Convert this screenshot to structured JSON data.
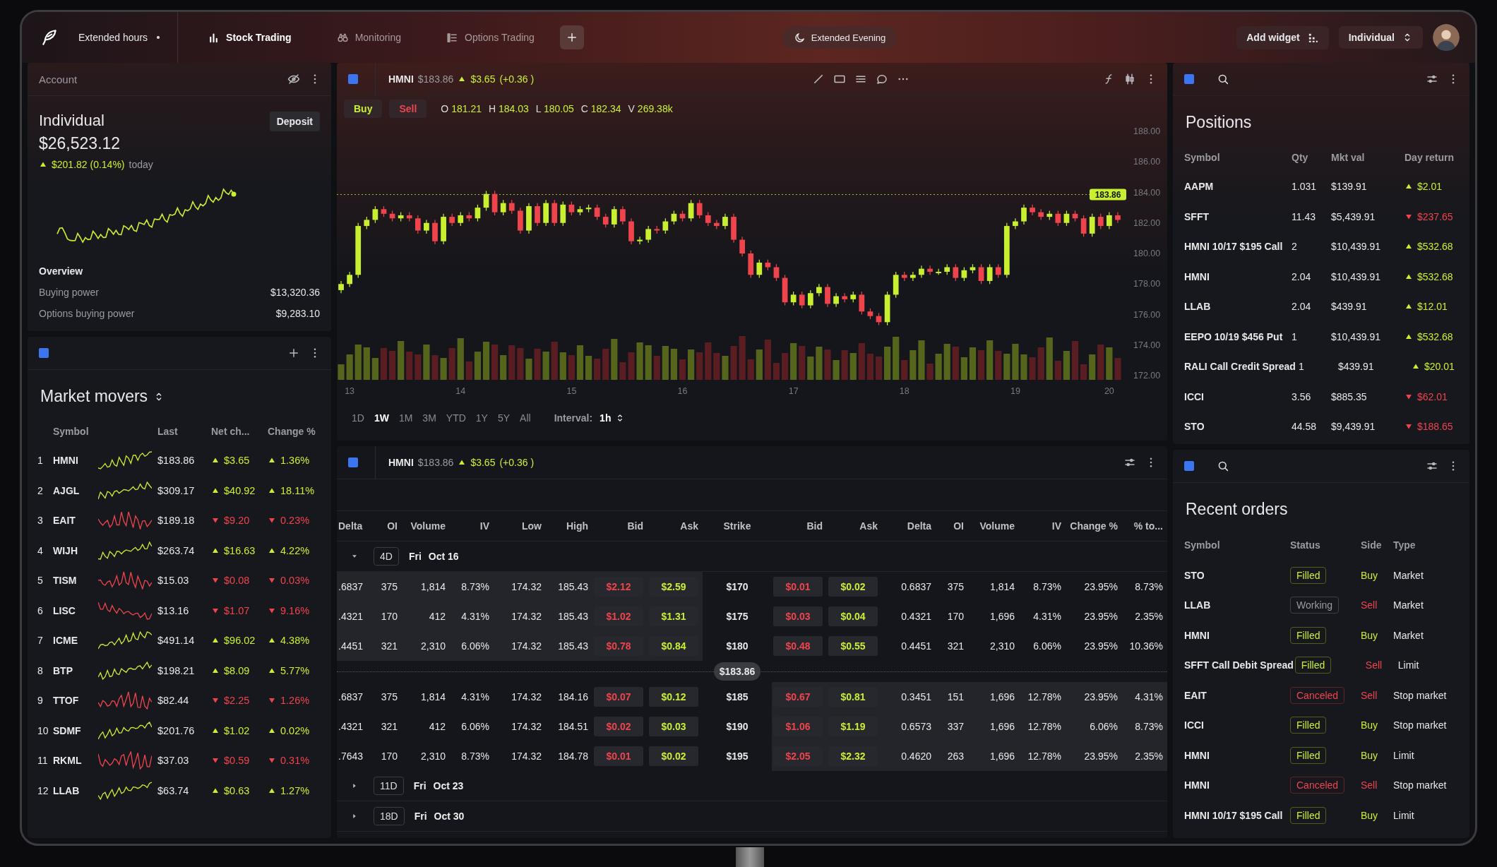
{
  "topbar": {
    "extended_hours": "Extended hours",
    "tabs": [
      {
        "label": "Stock Trading",
        "selected": true
      },
      {
        "label": "Monitoring",
        "selected": false
      },
      {
        "label": "Options Trading",
        "selected": false
      }
    ],
    "session": "Extended Evening",
    "add_widget": "Add widget",
    "account_menu": "Individual"
  },
  "account": {
    "title": "Account",
    "name": "Individual",
    "deposit": "Deposit",
    "balance": "$26,523.12",
    "change": "$201.82 (0.14%)",
    "rising": true,
    "period": "today",
    "overview_title": "Overview",
    "overview": [
      {
        "label": "Buying power",
        "value": "$13,320.36"
      },
      {
        "label": "Options buying power",
        "value": "$9,283.10"
      }
    ]
  },
  "market_movers": {
    "title": "Market movers",
    "columns": [
      "Symbol",
      "Last",
      "Net ch...",
      "Change %"
    ],
    "rows": [
      {
        "rank": "1",
        "symbol": "HMNI",
        "last": "$183.86",
        "net": "$3.65",
        "pct": "1.36%",
        "rising": true
      },
      {
        "rank": "2",
        "symbol": "AJGL",
        "last": "$309.17",
        "net": "$40.92",
        "pct": "18.11%",
        "rising": true
      },
      {
        "rank": "3",
        "symbol": "EAIT",
        "last": "$189.18",
        "net": "$9.20",
        "pct": "0.23%",
        "rising": false
      },
      {
        "rank": "4",
        "symbol": "WIJH",
        "last": "$263.74",
        "net": "$16.63",
        "pct": "4.22%",
        "rising": true
      },
      {
        "rank": "5",
        "symbol": "TISM",
        "last": "$15.03",
        "net": "$0.08",
        "pct": "0.03%",
        "rising": false
      },
      {
        "rank": "6",
        "symbol": "LISC",
        "last": "$13.16",
        "net": "$1.07",
        "pct": "9.16%",
        "rising": false
      },
      {
        "rank": "7",
        "symbol": "ICME",
        "last": "$491.14",
        "net": "$96.02",
        "pct": "4.38%",
        "rising": true
      },
      {
        "rank": "8",
        "symbol": "BTP",
        "last": "$198.21",
        "net": "$8.09",
        "pct": "5.77%",
        "rising": true
      },
      {
        "rank": "9",
        "symbol": "TTOF",
        "last": "$82.44",
        "net": "$2.25",
        "pct": "1.26%",
        "rising": false
      },
      {
        "rank": "10",
        "symbol": "SDMF",
        "last": "$201.76",
        "net": "$1.02",
        "pct": "0.02%",
        "rising": true
      },
      {
        "rank": "11",
        "symbol": "RKML",
        "last": "$37.03",
        "net": "$0.59",
        "pct": "0.31%",
        "rising": false
      },
      {
        "rank": "12",
        "symbol": "LLAB",
        "last": "$63.74",
        "net": "$0.63",
        "pct": "1.27%",
        "rising": true
      }
    ]
  },
  "chart": {
    "symbol": "HMNI",
    "price": "$183.86",
    "change": "$3.65",
    "change_pct": "(+0.36 )",
    "rising": true,
    "buy": "Buy",
    "sell": "Sell",
    "ohlcv": [
      {
        "label": "O",
        "value": "181.21"
      },
      {
        "label": "H",
        "value": "184.03"
      },
      {
        "label": "L",
        "value": "180.05"
      },
      {
        "label": "C",
        "value": "182.34"
      },
      {
        "label": "V",
        "value": "269.38k"
      }
    ],
    "last_price_tag": "183.86",
    "ranges": [
      {
        "label": "1D",
        "selected": false
      },
      {
        "label": "1W",
        "selected": true
      },
      {
        "label": "1M",
        "selected": false
      },
      {
        "label": "3M",
        "selected": false
      },
      {
        "label": "YTD",
        "selected": false
      },
      {
        "label": "1Y",
        "selected": false
      },
      {
        "label": "5Y",
        "selected": false
      },
      {
        "label": "All",
        "selected": false
      }
    ],
    "interval_label": "Interval:",
    "interval": "1h",
    "chart_data": {
      "type": "candlestick",
      "ylim": [
        172,
        188
      ],
      "yticks": [
        {
          "value": 172,
          "label": "172.00"
        },
        {
          "value": 174,
          "label": "174.00"
        },
        {
          "value": 176,
          "label": "176.00"
        },
        {
          "value": 178,
          "label": "178.00"
        },
        {
          "value": 180,
          "label": "180.00"
        },
        {
          "value": 182,
          "label": "182.00"
        },
        {
          "value": 184,
          "label": "184.00"
        },
        {
          "value": 186,
          "label": "186.00"
        },
        {
          "value": 188,
          "label": "188.00"
        }
      ],
      "categories": [
        null,
        "13",
        null,
        null,
        null,
        null,
        null,
        null,
        null,
        null,
        null,
        null,
        null,
        null,
        "14",
        null,
        null,
        null,
        null,
        null,
        null,
        null,
        null,
        null,
        null,
        null,
        null,
        "15",
        null,
        null,
        null,
        null,
        null,
        null,
        null,
        null,
        null,
        null,
        null,
        null,
        "16",
        null,
        null,
        null,
        null,
        null,
        null,
        null,
        null,
        null,
        null,
        null,
        null,
        "17",
        null,
        null,
        null,
        null,
        null,
        null,
        null,
        null,
        null,
        null,
        null,
        null,
        "18",
        null,
        null,
        null,
        null,
        null,
        null,
        null,
        null,
        null,
        null,
        null,
        null,
        "19",
        null,
        null,
        null,
        null,
        null,
        null,
        null,
        null,
        null,
        null,
        "20",
        null
      ],
      "ohlc": [
        [
          177.6,
          178.2,
          177.4,
          178.0
        ],
        [
          178.0,
          178.8,
          177.8,
          178.6
        ],
        [
          178.6,
          182.0,
          178.4,
          181.8
        ],
        [
          181.8,
          182.4,
          181.6,
          182.2
        ],
        [
          182.2,
          183.1,
          182.0,
          182.9
        ],
        [
          182.9,
          183.1,
          182.4,
          182.6
        ],
        [
          182.6,
          182.8,
          182.1,
          182.3
        ],
        [
          182.3,
          182.7,
          182.1,
          182.5
        ],
        [
          182.5,
          182.7,
          182.1,
          182.3
        ],
        [
          182.3,
          182.5,
          181.3,
          181.5
        ],
        [
          181.5,
          182.2,
          181.3,
          182.0
        ],
        [
          182.0,
          182.2,
          180.6,
          180.8
        ],
        [
          180.8,
          182.6,
          180.6,
          182.4
        ],
        [
          182.4,
          182.6,
          181.8,
          182.0
        ],
        [
          182.0,
          182.7,
          181.8,
          182.5
        ],
        [
          182.5,
          182.7,
          182.1,
          182.3
        ],
        [
          182.3,
          183.2,
          182.1,
          183.0
        ],
        [
          183.0,
          184.1,
          182.8,
          183.9
        ],
        [
          183.9,
          184.1,
          182.5,
          182.7
        ],
        [
          182.7,
          183.5,
          182.5,
          183.3
        ],
        [
          183.3,
          183.5,
          182.6,
          182.8
        ],
        [
          182.8,
          183.0,
          181.3,
          181.5
        ],
        [
          181.5,
          183.3,
          181.3,
          183.1
        ],
        [
          183.1,
          183.3,
          181.8,
          182.0
        ],
        [
          182.0,
          183.5,
          181.8,
          183.3
        ],
        [
          183.3,
          183.5,
          181.8,
          182.0
        ],
        [
          182.0,
          183.4,
          181.8,
          183.2
        ],
        [
          183.2,
          183.4,
          182.5,
          182.7
        ],
        [
          182.7,
          183.1,
          182.5,
          182.9
        ],
        [
          182.9,
          183.2,
          182.7,
          183.0
        ],
        [
          183.0,
          183.2,
          182.2,
          182.4
        ],
        [
          182.4,
          182.6,
          181.7,
          181.9
        ],
        [
          181.9,
          183.1,
          181.7,
          182.9
        ],
        [
          182.9,
          183.1,
          181.9,
          182.1
        ],
        [
          182.1,
          182.3,
          180.6,
          180.8
        ],
        [
          180.8,
          181.1,
          180.6,
          180.9
        ],
        [
          180.9,
          181.8,
          180.7,
          181.6
        ],
        [
          181.6,
          181.8,
          181.3,
          181.5
        ],
        [
          181.5,
          182.3,
          181.3,
          182.1
        ],
        [
          182.1,
          182.8,
          181.9,
          182.6
        ],
        [
          182.6,
          182.8,
          182.1,
          182.3
        ],
        [
          182.3,
          183.5,
          182.1,
          183.3
        ],
        [
          183.3,
          183.5,
          182.3,
          182.5
        ],
        [
          182.5,
          182.7,
          181.8,
          182.0
        ],
        [
          182.0,
          182.2,
          181.6,
          181.8
        ],
        [
          181.8,
          182.6,
          181.6,
          182.4
        ],
        [
          182.4,
          182.6,
          180.7,
          180.9
        ],
        [
          180.9,
          181.1,
          179.8,
          180.0
        ],
        [
          180.0,
          180.2,
          178.4,
          178.6
        ],
        [
          178.6,
          179.6,
          178.4,
          179.4
        ],
        [
          179.4,
          179.6,
          178.9,
          179.1
        ],
        [
          179.1,
          179.3,
          178.2,
          178.4
        ],
        [
          178.4,
          178.6,
          176.6,
          176.8
        ],
        [
          176.8,
          177.5,
          176.6,
          177.3
        ],
        [
          177.3,
          177.5,
          176.4,
          176.6
        ],
        [
          176.6,
          177.6,
          176.4,
          177.4
        ],
        [
          177.4,
          178.0,
          177.2,
          177.8
        ],
        [
          177.8,
          178.0,
          176.5,
          176.7
        ],
        [
          176.7,
          177.4,
          176.5,
          177.2
        ],
        [
          177.2,
          177.4,
          176.8,
          177.0
        ],
        [
          177.0,
          177.5,
          176.8,
          177.3
        ],
        [
          177.3,
          177.5,
          176.0,
          176.2
        ],
        [
          176.2,
          176.4,
          175.7,
          175.9
        ],
        [
          175.9,
          176.1,
          175.3,
          175.5
        ],
        [
          175.5,
          177.5,
          175.3,
          177.3
        ],
        [
          177.3,
          178.8,
          177.1,
          178.6
        ],
        [
          178.6,
          178.8,
          178.2,
          178.4
        ],
        [
          178.4,
          178.8,
          178.2,
          178.6
        ],
        [
          178.6,
          179.2,
          178.4,
          179.0
        ],
        [
          179.0,
          179.2,
          178.6,
          178.8
        ],
        [
          178.8,
          179.0,
          178.6,
          178.8
        ],
        [
          178.8,
          179.3,
          178.6,
          179.1
        ],
        [
          179.1,
          179.3,
          178.2,
          178.4
        ],
        [
          178.4,
          179.1,
          178.2,
          178.9
        ],
        [
          178.9,
          179.3,
          178.7,
          179.1
        ],
        [
          179.1,
          179.3,
          178.0,
          178.2
        ],
        [
          178.2,
          179.3,
          178.0,
          179.1
        ],
        [
          179.1,
          179.3,
          178.4,
          178.6
        ],
        [
          178.6,
          182.0,
          178.4,
          181.8
        ],
        [
          181.8,
          182.3,
          181.6,
          182.1
        ],
        [
          182.1,
          183.2,
          181.9,
          183.0
        ],
        [
          183.0,
          183.2,
          182.5,
          182.7
        ],
        [
          182.7,
          182.9,
          182.2,
          182.4
        ],
        [
          182.4,
          182.8,
          182.2,
          182.6
        ],
        [
          182.6,
          182.8,
          181.8,
          182.0
        ],
        [
          182.0,
          182.8,
          181.8,
          182.6
        ],
        [
          182.6,
          182.8,
          182.1,
          182.3
        ],
        [
          182.3,
          182.5,
          181.1,
          181.3
        ],
        [
          181.3,
          182.6,
          181.1,
          182.4
        ],
        [
          182.4,
          182.6,
          181.6,
          181.8
        ],
        [
          181.8,
          182.7,
          181.6,
          182.5
        ],
        [
          182.5,
          182.7,
          182.0,
          182.2
        ]
      ]
    }
  },
  "options_chain": {
    "symbol": "HMNI",
    "price": "$183.86",
    "change": "$3.65",
    "change_pct": "(+0.36 )",
    "rising": true,
    "columns": [
      "Delta",
      "OI",
      "Volume",
      "IV",
      "Low",
      "High",
      "Bid",
      "Ask",
      "Strike",
      "Bid",
      "Ask",
      "Delta",
      "OI",
      "Volume",
      "IV",
      "Change %",
      "% to..."
    ],
    "expirations": [
      {
        "days": "4D",
        "weekday": "Fri",
        "date": "Oct 16",
        "expanded": true,
        "rows": [
          {
            "kind": "strike",
            "calls_shaded": true,
            "puts_shaded": false,
            "calls": [
              ".6837",
              "375",
              "1,814",
              "8.73%",
              "174.32",
              "185.43",
              "$2.12",
              "$2.59"
            ],
            "strike": "$170",
            "puts": [
              "$0.01",
              "$0.02",
              "0.6837",
              "375",
              "1,814",
              "8.73%",
              "23.95%",
              "8.73%"
            ]
          },
          {
            "kind": "strike",
            "calls_shaded": true,
            "puts_shaded": false,
            "calls": [
              ".4321",
              "170",
              "412",
              "4.31%",
              "174.32",
              "185.43",
              "$1.02",
              "$1.31"
            ],
            "strike": "$175",
            "puts": [
              "$0.03",
              "$0.04",
              "0.4321",
              "170",
              "1,696",
              "4.31%",
              "23.95%",
              "2.35%"
            ]
          },
          {
            "kind": "strike",
            "calls_shaded": true,
            "puts_shaded": false,
            "calls": [
              ".4451",
              "321",
              "2,310",
              "6.06%",
              "174.32",
              "185.43",
              "$0.78",
              "$0.84"
            ],
            "strike": "$180",
            "puts": [
              "$0.48",
              "$0.55",
              "0.4451",
              "321",
              "2,310",
              "6.06%",
              "23.95%",
              "10.36%"
            ]
          },
          {
            "kind": "price_line",
            "label": "$183.86"
          },
          {
            "kind": "strike",
            "calls_shaded": false,
            "puts_shaded": true,
            "calls": [
              ".6837",
              "375",
              "1,814",
              "4.31%",
              "174.32",
              "184.16",
              "$0.07",
              "$0.12"
            ],
            "strike": "$185",
            "puts": [
              "$0.67",
              "$0.81",
              "0.3451",
              "151",
              "1,696",
              "12.78%",
              "23.95%",
              "4.31%"
            ]
          },
          {
            "kind": "strike",
            "calls_shaded": false,
            "puts_shaded": true,
            "calls": [
              ".4321",
              "321",
              "412",
              "6.06%",
              "174.32",
              "184.51",
              "$0.02",
              "$0.03"
            ],
            "strike": "$190",
            "puts": [
              "$1.06",
              "$1.19",
              "0.6573",
              "337",
              "1,696",
              "12.78%",
              "6.06%",
              "8.73%"
            ]
          },
          {
            "kind": "strike",
            "calls_shaded": false,
            "puts_shaded": true,
            "calls": [
              ".7643",
              "170",
              "2,310",
              "8.73%",
              "174.32",
              "184.78",
              "$0.01",
              "$0.02"
            ],
            "strike": "$195",
            "puts": [
              "$2.05",
              "$2.32",
              "0.4620",
              "263",
              "1,696",
              "12.78%",
              "23.95%",
              "2.35%"
            ]
          }
        ]
      },
      {
        "days": "11D",
        "weekday": "Fri",
        "date": "Oct 23",
        "expanded": false
      },
      {
        "days": "18D",
        "weekday": "Fri",
        "date": "Oct 30",
        "expanded": false
      }
    ]
  },
  "positions": {
    "title": "Positions",
    "columns": [
      "Symbol",
      "Qty",
      "Mkt val",
      "Day return"
    ],
    "rows": [
      {
        "symbol": "AAPM",
        "qty": "1.031",
        "value": "$139.91",
        "return": "$2.01",
        "rising": true
      },
      {
        "symbol": "SFFT",
        "qty": "11.43",
        "value": "$5,439.91",
        "return": "$237.65",
        "rising": false
      },
      {
        "symbol": "HMNI 10/17 $195 Call",
        "qty": "2",
        "value": "$10,439.91",
        "return": "$532.68",
        "rising": true
      },
      {
        "symbol": "HMNI",
        "qty": "2.04",
        "value": "$10,439.91",
        "return": "$532.68",
        "rising": true
      },
      {
        "symbol": "LLAB",
        "qty": "2.04",
        "value": "$439.91",
        "return": "$12.01",
        "rising": true
      },
      {
        "symbol": "EEPO 10/19 $456 Put",
        "qty": "1",
        "value": "$10,439.91",
        "return": "$532.68",
        "rising": true
      },
      {
        "symbol": "RALI Call Credit Spread",
        "qty": "1",
        "value": "$439.91",
        "return": "$20.01",
        "rising": true
      },
      {
        "symbol": "ICCI",
        "qty": "3.56",
        "value": "$885.35",
        "return": "$62.01",
        "rising": false
      },
      {
        "symbol": "STO",
        "qty": "44.58",
        "value": "$9,439.91",
        "return": "$188.65",
        "rising": false
      }
    ]
  },
  "recent_orders": {
    "title": "Recent orders",
    "columns": [
      "Symbol",
      "Status",
      "Side",
      "Type"
    ],
    "rows": [
      {
        "symbol": "STO",
        "status": "Filled",
        "kind": "filled",
        "side": "Buy",
        "sell": false,
        "type": "Market"
      },
      {
        "symbol": "LLAB",
        "status": "Working",
        "kind": "working",
        "side": "Sell",
        "sell": true,
        "type": "Market"
      },
      {
        "symbol": "HMNI",
        "status": "Filled",
        "kind": "filled",
        "side": "Buy",
        "sell": false,
        "type": "Market"
      },
      {
        "symbol": "SFFT Call Debit Spread",
        "status": "Filled",
        "kind": "filled",
        "side": "Sell",
        "sell": true,
        "type": "Limit"
      },
      {
        "symbol": "EAIT",
        "status": "Canceled",
        "kind": "canceled",
        "side": "Sell",
        "sell": true,
        "type": "Stop market"
      },
      {
        "symbol": "ICCI",
        "status": "Filled",
        "kind": "filled",
        "side": "Buy",
        "sell": false,
        "type": "Stop market"
      },
      {
        "symbol": "HMNI",
        "status": "Filled",
        "kind": "filled",
        "side": "Buy",
        "sell": false,
        "type": "Limit"
      },
      {
        "symbol": "HMNI",
        "status": "Canceled",
        "kind": "canceled",
        "side": "Sell",
        "sell": true,
        "type": "Stop market"
      },
      {
        "symbol": "HMNI 10/17 $195 Call",
        "status": "Filled",
        "kind": "filled",
        "side": "Buy",
        "sell": false,
        "type": "Limit"
      }
    ]
  }
}
